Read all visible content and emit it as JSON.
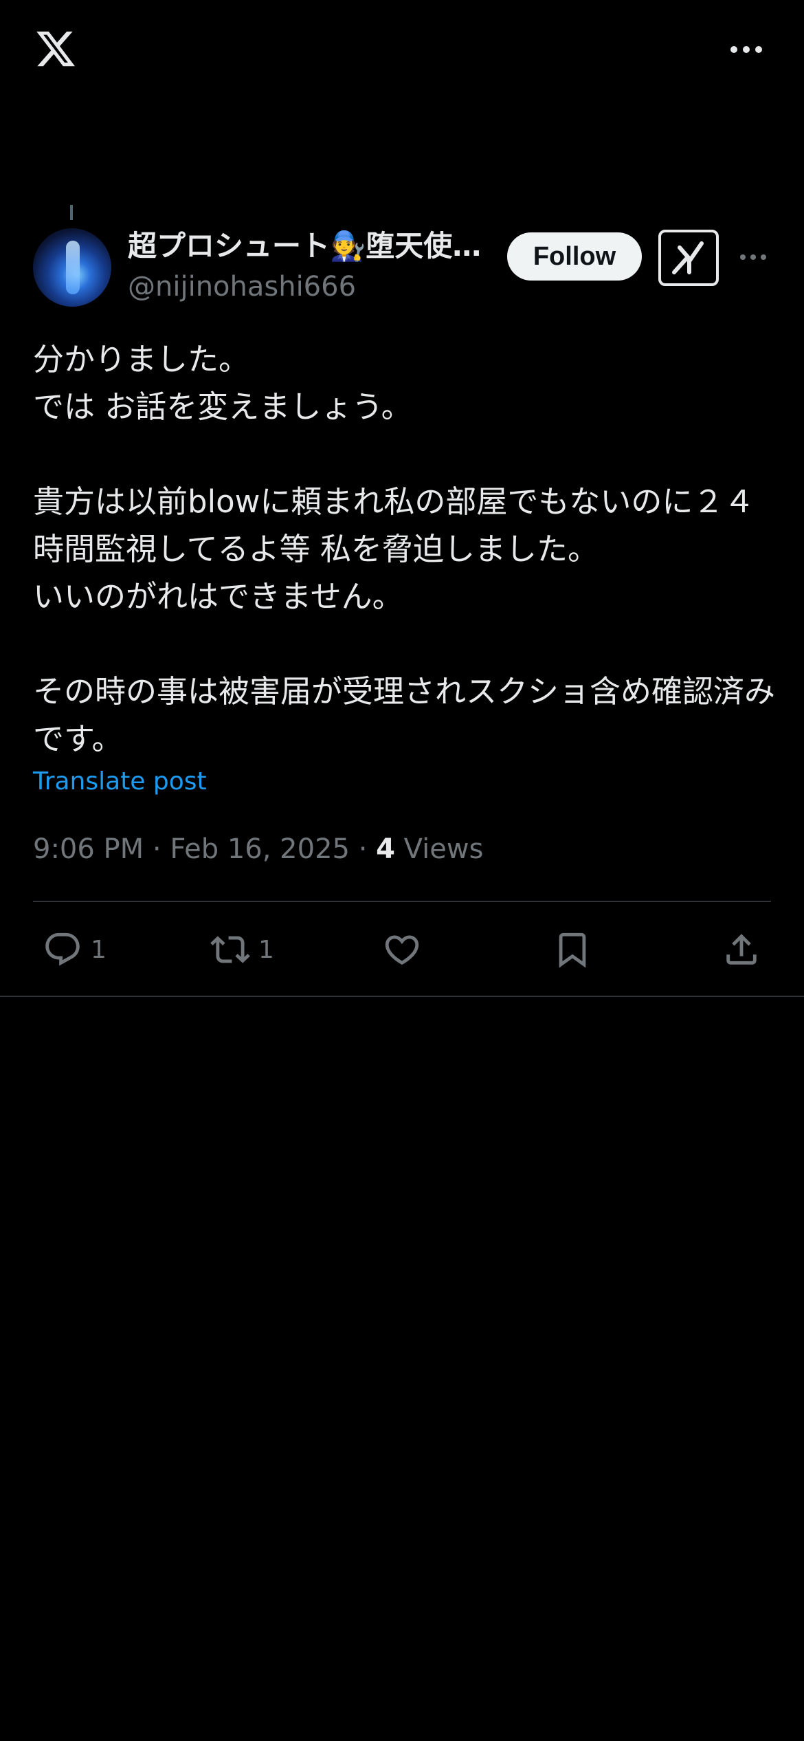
{
  "topbar": {
    "logo": "x-logo-icon",
    "more": "more-horizontal-icon"
  },
  "author": {
    "display_name": "超プロシュート🧑‍🔧堕天使…",
    "handle": "@nijinohashi666",
    "avatar": "avatar"
  },
  "actions_top": {
    "follow_label": "Follow",
    "grok_icon": "grok-icon"
  },
  "post": {
    "text": "分かりました。\nでは お話を変えましょう。\n\n貴方は以前blowに頼まれ私の部屋でもないのに２４時間監視してるよ等 私を脅迫しました。\nいいのがれはできません。\n\nその時の事は被害届が受理されスクショ含め確認済みです。",
    "translate_label": "Translate post",
    "timestamp": "9:06 PM · Feb 16, 2025 · ",
    "views_count": "4",
    "views_label": " Views"
  },
  "engagement": {
    "replies": "1",
    "reposts": "1"
  },
  "colors": {
    "background": "#000000",
    "text": "#e7e9ea",
    "muted": "#71767b",
    "link": "#1d9bf0",
    "divider": "#2f3336"
  }
}
